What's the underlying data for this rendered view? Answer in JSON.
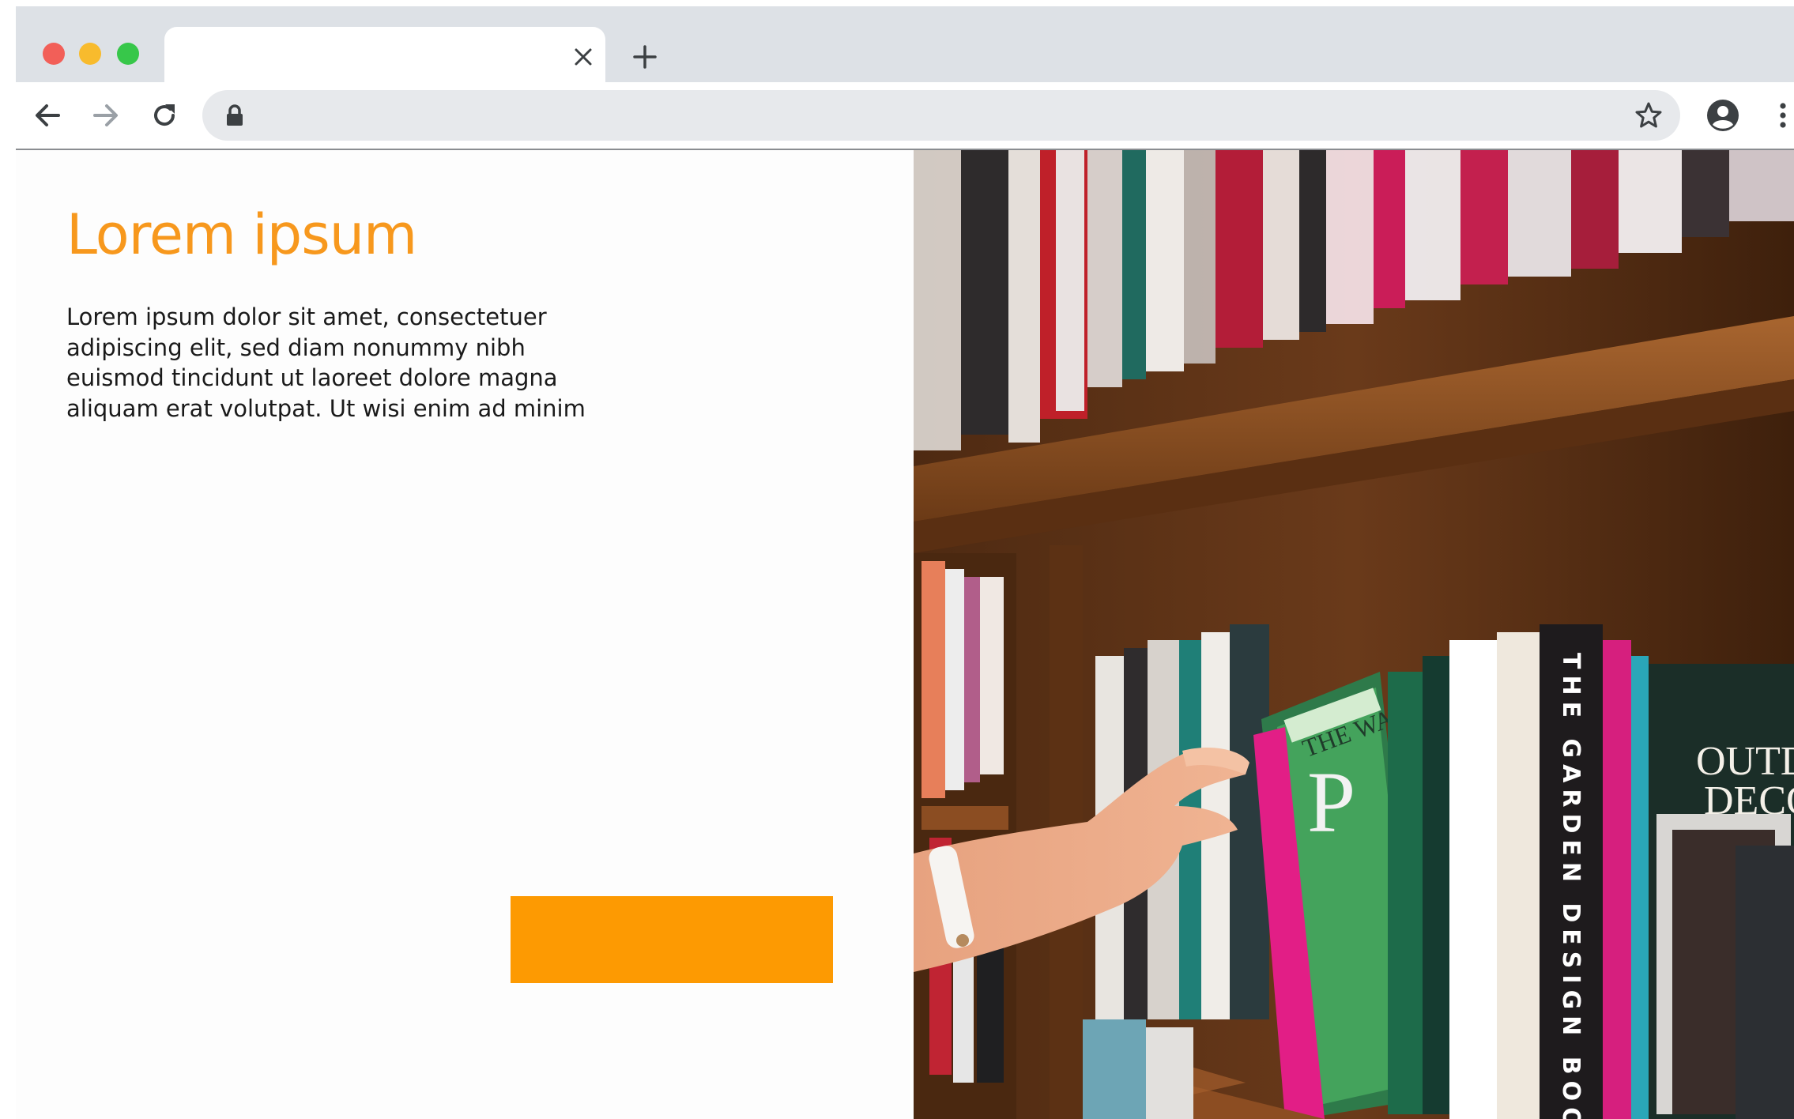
{
  "browser": {
    "tab_title": "",
    "address": "",
    "buttons": {
      "back": "back-arrow-icon",
      "forward": "forward-arrow-icon",
      "reload": "reload-icon",
      "close_tab": "close-icon",
      "new_tab": "plus-icon",
      "lock": "lock-icon",
      "bookmark": "star-icon",
      "profile": "account-circle-icon",
      "menu": "kebab-menu-icon"
    },
    "traffic_light_colors": [
      "#f25f58",
      "#f8bb2d",
      "#37c74a"
    ]
  },
  "page": {
    "title": "Lorem ipsum",
    "body": "Lorem ipsum dolor sit amet, consectetuer adipiscing elit, sed diam nonummy nibh euismod tincidunt ut laoreet dolore magna aliquam erat volutpat. Ut wisi enim ad minim",
    "cta_label": "",
    "image": {
      "subject": "photo-library-bookshelf",
      "printed_text": [
        "THE WAY",
        "P",
        "THE GARDEN DESIGN BOOK",
        "OUTDOOR DECOR"
      ]
    }
  },
  "colors": {
    "accent": "#f7981d",
    "cta_background": "#fd9a02",
    "tabbar": "#dde1e6",
    "omnibox": "#e7e9ec",
    "body_text": "#1a1a1a"
  }
}
